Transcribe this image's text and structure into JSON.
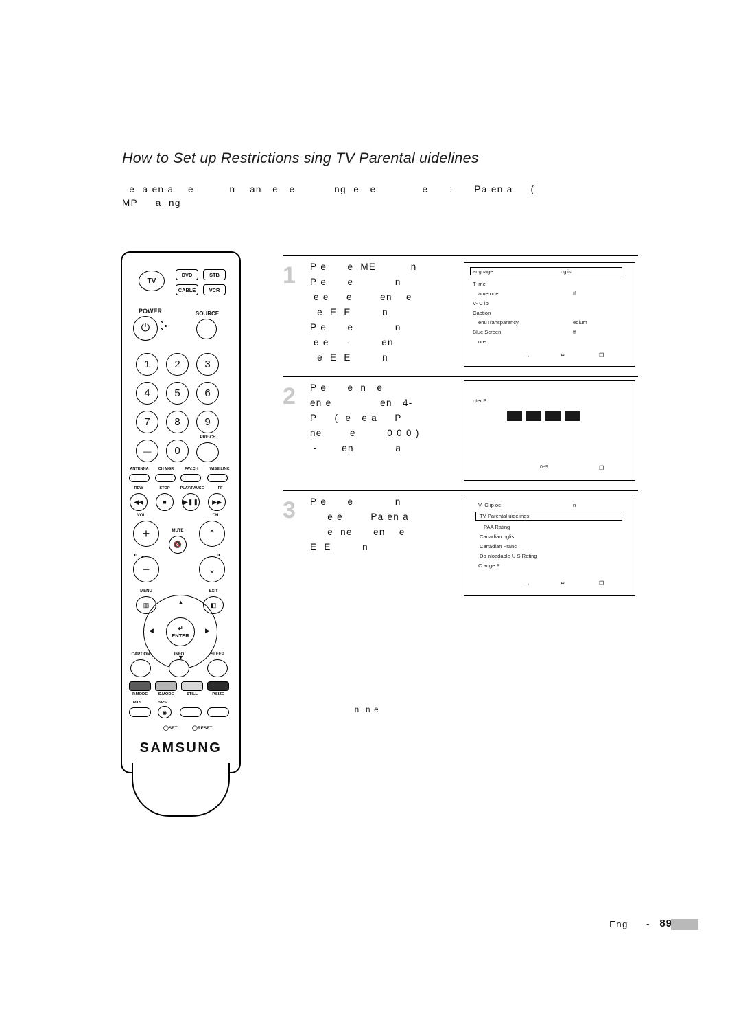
{
  "heading": "How to Set up Restrictions  sing TV Parental  uidelines",
  "intro": "  e  a en a    e          n    an   e   e           ng  e   e             e      :      Pa en a     (\nMP     a  ng ",
  "steps": [
    {
      "num": "1",
      "text": "P e      e  ME          n \nP e      e            n    \n e e     e        en    e\n  e  E  E         n \nP e      e            n    \n e e     -         en    \n  e  E  E         n "
    },
    {
      "num": "2",
      "text": "P e      e  n   e        \nen e              en   4- \nP     (  e   e a     P  \nne        e         0 0 0 )\n -       en            a "
    },
    {
      "num": "3",
      "text": "P e      e            n\n     e e        Pa en a \n     e  ne      en    e  \nE  E         n "
    }
  ],
  "osd1": {
    "title_label": "anguage",
    "title_value": "nglis",
    "rows": [
      {
        "label": "T ime",
        "value": ""
      },
      {
        "label": "ame  ode",
        "value": "ff",
        "indent": true
      },
      {
        "label": "V- C ip",
        "value": ""
      },
      {
        "label": "Caption",
        "value": ""
      },
      {
        "label": "enuTransparency",
        "value": "edium",
        "indent": true
      },
      {
        "label": "Blue Screen",
        "value": "ff"
      },
      {
        "label": "ore",
        "value": "",
        "indent": true
      }
    ],
    "footer": {
      "move": "→",
      "enter": "↵",
      "return": "❒"
    }
  },
  "osd2": {
    "prompt": "nter P",
    "pin_digits": 4,
    "footer": {
      "number": "0~9",
      "return": "❒"
    }
  },
  "osd3": {
    "title_label": "V- C ip  oc",
    "title_value": "n",
    "rows": [
      {
        "label": "TV Parental  uidelines",
        "highlight": true
      },
      {
        "label": "PAA Rating"
      },
      {
        "label": "Canadian  nglis"
      },
      {
        "label": "Canadian  Franc"
      },
      {
        "label": "Do nloadable U S  Rating"
      },
      {
        "label": "C ange P"
      }
    ],
    "footer": {
      "move": "→",
      "enter": "↵",
      "return": "❒"
    }
  },
  "note": "  n  n e    ",
  "footer": {
    "text": "Eng      -",
    "page": "89"
  },
  "remote": {
    "source_labels": {
      "tv": "TV",
      "dvd": "DVD",
      "stb": "STB",
      "cable": "CABLE",
      "vcr": "VCR"
    },
    "power_label": "POWER",
    "source_button_label": "SOURCE",
    "numbers": [
      "1",
      "2",
      "3",
      "4",
      "5",
      "6",
      "7",
      "8",
      "9",
      "0"
    ],
    "minus_label": "—",
    "prech_label": "PRE-CH",
    "func_row": [
      "ANTENNA",
      "CH MGR",
      "FAV.CH",
      "WISE LINK"
    ],
    "transport_row": [
      "REW",
      "STOP",
      "PLAY/PAUSE",
      "FF"
    ],
    "vol_label": "VOL",
    "ch_label": "CH",
    "mute_label": "MUTE",
    "menu_label": "MENU",
    "exit_label": "EXIT",
    "enter_label": "ENTER",
    "bottom_round": [
      "CAPTION",
      "INFO",
      "SLEEP"
    ],
    "mode_row": [
      "P.MODE",
      "S.MODE",
      "STILL",
      "P.SIZE"
    ],
    "bottom_row": [
      "MTS",
      "SRS"
    ],
    "set_label": "SET",
    "reset_label": "RESET",
    "brand": "SAMSUNG"
  }
}
